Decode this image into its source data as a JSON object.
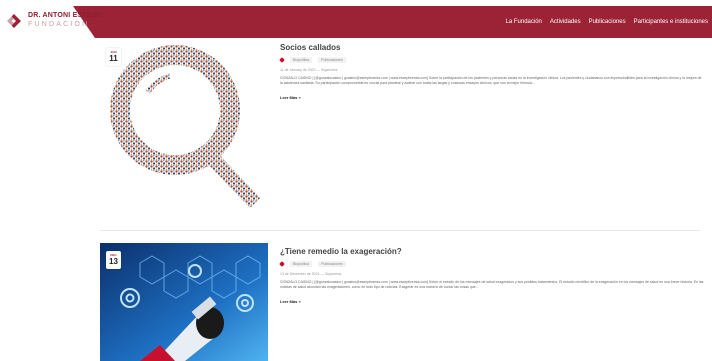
{
  "header": {
    "logo_line1": "DR. ANTONI ESTEVE",
    "logo_line2": "FUNDACIÓN",
    "nav": [
      "La Fundación",
      "Actividades",
      "Publicaciones",
      "Participantes e instituciones"
    ]
  },
  "posts": [
    {
      "title": "Socios callados",
      "badge_month": "JUN",
      "badge_day": "11",
      "categories": [
        "Biopolítica",
        "Publicaciones"
      ],
      "meta": "11 de January de 2022 — Sujanchos",
      "excerpt": "GONZALO CASINO | [@gonzalocasino | gcasino@escepticemia.com | www.escepticemia.com] Sobre la participación de los pacientes y personas sanas en la investigación clínica. Los pacientes y ciudadanos son imprescindibles para la investigación clínica y la mejora de la asistencia sanitaria. Su participación comprometida es crucial para plantear y acabar con todas las largas y costosas ensayos clínicos, que son la mejor fórmula...",
      "read_more": "Leer Más »",
      "image": "crowd-magnifying-glass"
    },
    {
      "title": "¿Tiene remedio la exageración?",
      "badge_month": "DEC",
      "badge_day": "13",
      "categories": [
        "Biopolítica",
        "Publicaciones"
      ],
      "meta": "13 de December de 2021 — Sujanchos",
      "excerpt": "GONZALO CASINO | [@gonzalocasino | gcasino@escepticemia.com | www.escepticemia.com] Sobre el estudio de los mensajes de salud exagerados y sus posibles tratamientos. El estudio científico de la exageración en los mensajes de salud es una breve historia. En las noticias de salud abundan las exageraciones, como en todo tipo de noticias. Exagerar es una manera de contar las cosas que...",
      "read_more": "Leer Más »",
      "image": "megaphone-gears"
    }
  ],
  "colors": {
    "brand": "#9b2335",
    "tag": "#c8102e"
  }
}
